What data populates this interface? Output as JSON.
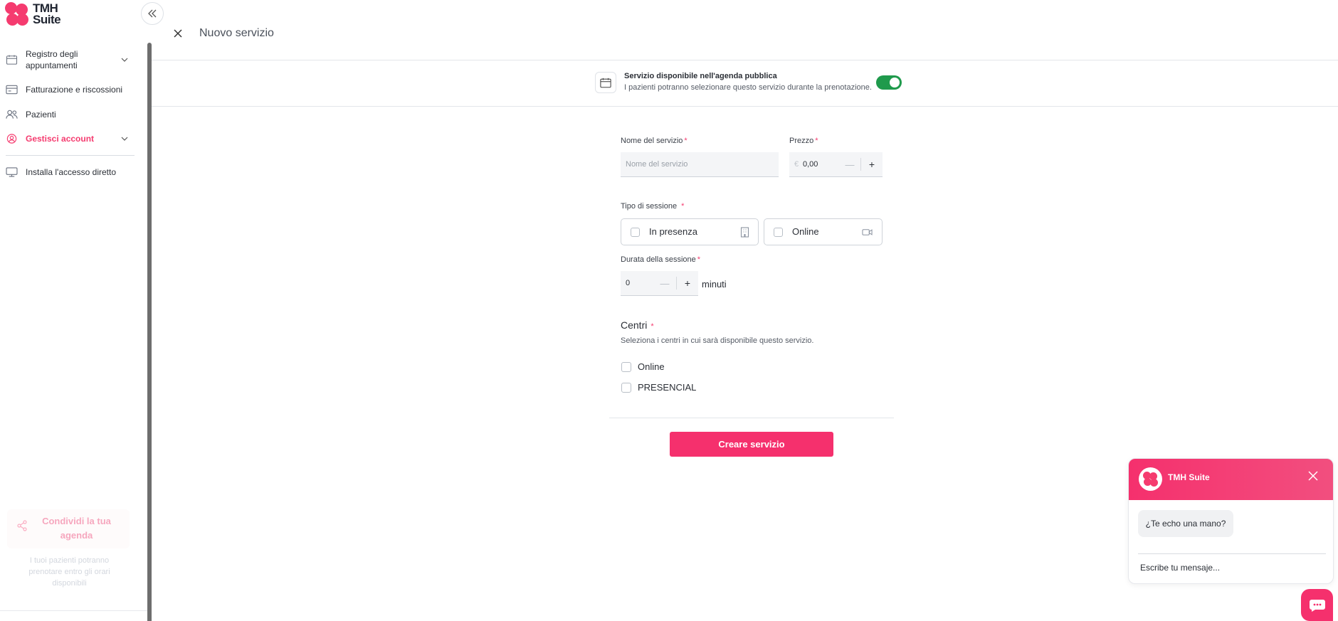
{
  "brand": {
    "name_line1": "TMH",
    "name_line2": "Suite",
    "accent": "#f53b6f"
  },
  "sidebar": {
    "items": [
      {
        "label": "Registro degli appuntamenti",
        "icon": "calendar-icon"
      },
      {
        "label": "Fatturazione e riscossioni",
        "icon": "billing-icon"
      },
      {
        "label": "Pazienti",
        "icon": "users-icon"
      },
      {
        "label": "Gestisci account",
        "icon": "account-icon",
        "active": true
      },
      {
        "label": "Installa l'accesso diretto",
        "icon": "monitor-icon"
      }
    ],
    "share": {
      "title": "Condividi la tua agenda",
      "text": "I tuoi pazienti potranno prenotare entro gli orari disponibili"
    }
  },
  "header": {
    "title": "Nuovo servizio"
  },
  "public_agenda": {
    "title": "Servizio disponibile nell'agenda pubblica",
    "subtitle": "I pazienti potranno selezionare questo servizio durante la prenotazione.",
    "enabled": true
  },
  "form": {
    "service_name": {
      "label": "Nome del servizio",
      "placeholder": "Nome del servizio",
      "required_mark": "*"
    },
    "price": {
      "label": "Prezzo",
      "currency": "€",
      "value": "0,00",
      "required_mark": "*",
      "minus": "—",
      "plus": "+"
    },
    "session_type": {
      "label": "Tipo di sessione",
      "required_mark": "*",
      "options": [
        {
          "label": "In presenza",
          "icon": "building-icon",
          "checked": false
        },
        {
          "label": "Online",
          "icon": "video-icon",
          "checked": false
        }
      ]
    },
    "duration": {
      "label": "Durata della sessione",
      "required_mark": "*",
      "value": "0",
      "unit": "minuti",
      "minus": "—",
      "plus": "+"
    },
    "centers": {
      "title": "Centri",
      "required_mark": "*",
      "help": "Seleziona i centri in cui sarà disponibile questo servizio.",
      "options": [
        {
          "label": "Online",
          "checked": false
        },
        {
          "label": "PRESENCIAL",
          "checked": false
        }
      ]
    },
    "submit_label": "Creare servizio"
  },
  "chat": {
    "name": "TMH Suite",
    "greeting": "¿Te echo una mano?",
    "input_placeholder": "Escribe tu mensaje..."
  }
}
